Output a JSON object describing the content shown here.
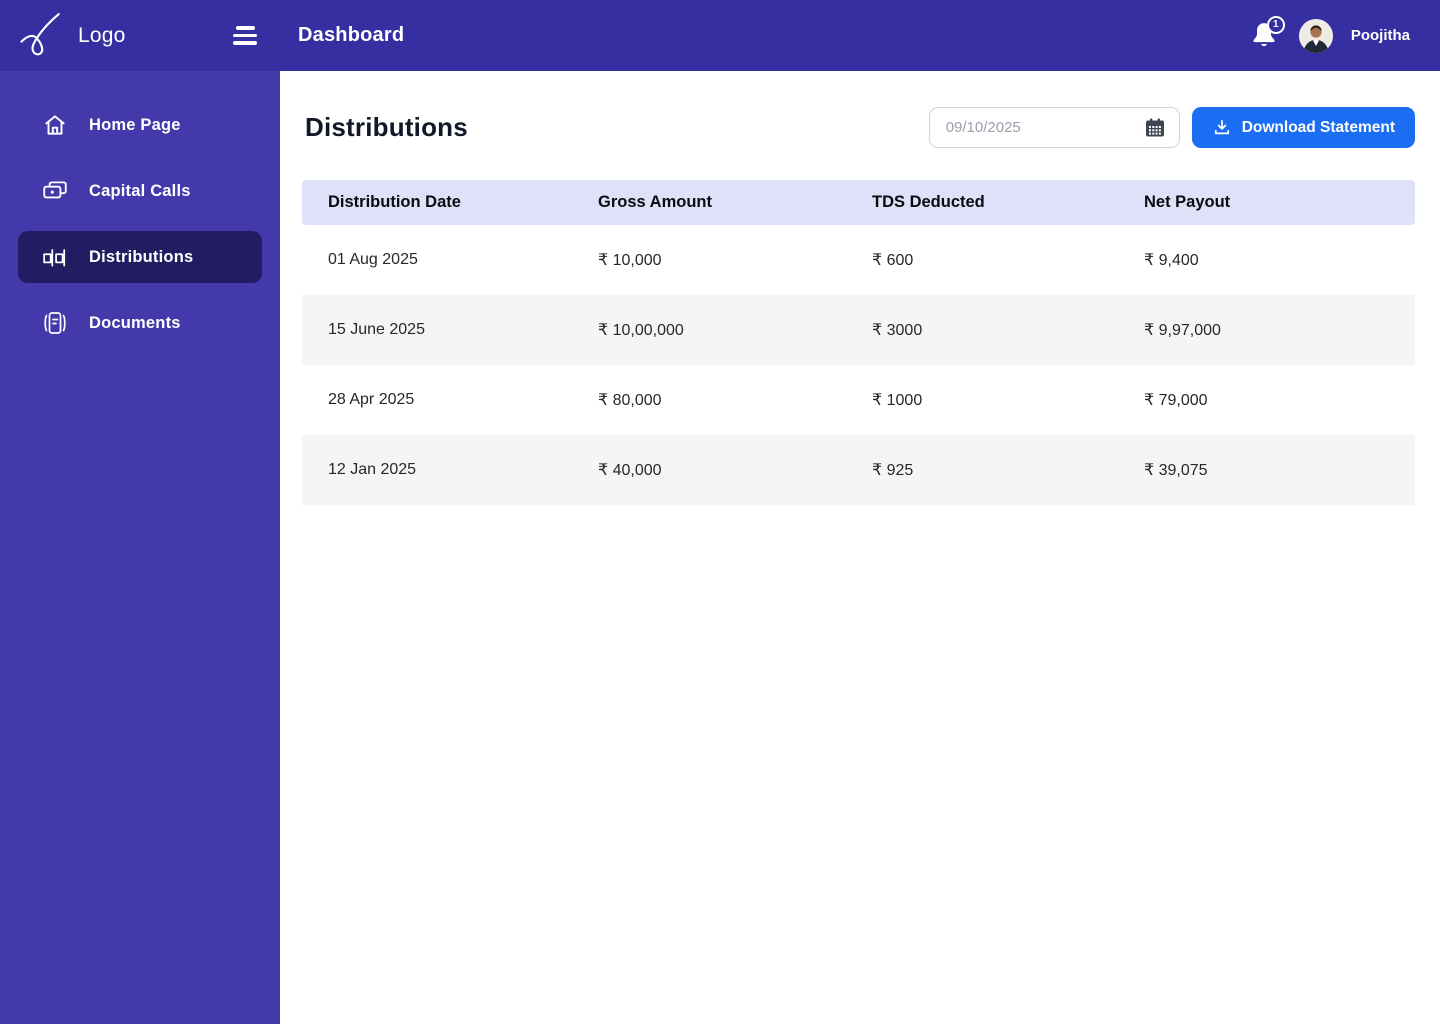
{
  "header": {
    "logo_text": "Logo",
    "title": "Dashboard",
    "notification_count": "1",
    "user_name": "Poojitha"
  },
  "sidebar": {
    "items": [
      {
        "label": "Home Page",
        "icon": "home-icon",
        "active": false
      },
      {
        "label": "Capital Calls",
        "icon": "capital-calls-icon",
        "active": false
      },
      {
        "label": "Distributions",
        "icon": "distributions-icon",
        "active": true
      },
      {
        "label": "Documents",
        "icon": "documents-icon",
        "active": false
      }
    ]
  },
  "main": {
    "title": "Distributions",
    "date_filter": {
      "value": "09/10/2025"
    },
    "download_button_label": "Download Statement",
    "table": {
      "columns": [
        "Distribution Date",
        "Gross Amount",
        "TDS Deducted",
        "Net Payout"
      ],
      "rows": [
        [
          "01 Aug 2025",
          "₹ 10,000",
          "₹ 600",
          "₹ 9,400"
        ],
        [
          "15 June 2025",
          "₹ 10,00,000",
          "₹ 3000",
          "₹ 9,97,000"
        ],
        [
          "28 Apr 2025",
          "₹ 80,000",
          "₹ 1000",
          "₹ 79,000"
        ],
        [
          "12 Jan 2025",
          "₹ 40,000",
          "₹ 925",
          "₹ 39,075"
        ]
      ]
    }
  },
  "colors": {
    "topbar_bg": "#362fa2",
    "sidebar_bg": "#4339ab",
    "sidebar_active_bg": "#221d63",
    "accent_blue": "#1b6ef3",
    "table_header_bg": "#dfe1f9",
    "row_alt_bg": "#f5f5f5"
  }
}
